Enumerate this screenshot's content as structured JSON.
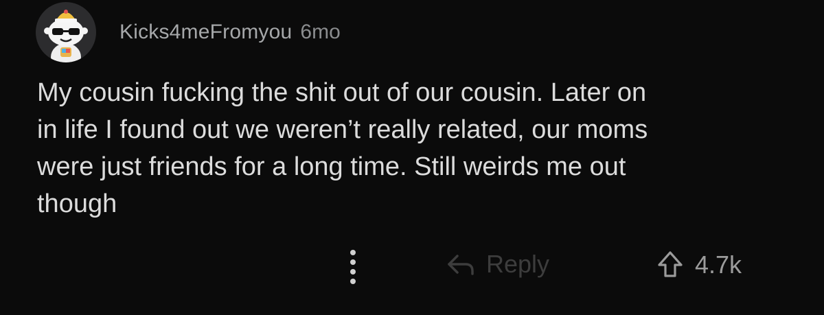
{
  "comment": {
    "author": "Kicks4meFromyou",
    "age": "6mo",
    "avatar_icon": "snoo-avatar-sunglasses",
    "body": "My cousin fucking the shit out of our cousin. Later on\nin life I found out we weren’t really related, our moms\nwere just friends for a long time. Still weirds me out\nthough",
    "actions": {
      "more_icon": "vertical-dots-icon",
      "reply_icon": "reply-arrow-icon",
      "reply_label": "Reply",
      "upvote_icon": "upvote-arrow-icon",
      "score": "4.7k"
    }
  },
  "colors": {
    "background": "#0b0b0b",
    "text": "#dcdcdc",
    "meta": "#a6a8aa",
    "reply_dim": "#3d3d3d"
  }
}
